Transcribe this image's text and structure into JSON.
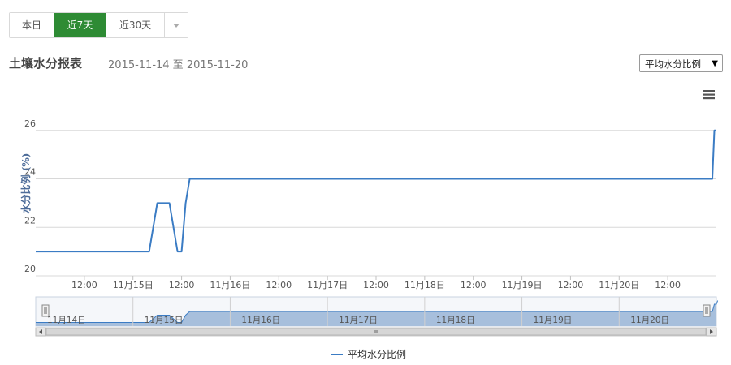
{
  "tabs": [
    {
      "label": "本日",
      "active": false
    },
    {
      "label": "近7天",
      "active": true
    },
    {
      "label": "近30天",
      "active": false
    }
  ],
  "title": "土壤水分报表",
  "date_range": "2015-11-14 至 2015-11-20",
  "metric_select": {
    "value": "平均水分比例"
  },
  "colors": {
    "accent": "#2e8b34",
    "series": "#3b7cc4",
    "navigator_fill": "#a7bfdc"
  },
  "chart_data": {
    "type": "line",
    "ylabel": "水分比例 (%)",
    "ylim": [
      20,
      27.9
    ],
    "yticks": [
      20,
      22,
      24,
      26
    ],
    "x_range": [
      "2015-11-14 00:00",
      "2015-11-21 00:00"
    ],
    "x_tick_labels": [
      "12:00",
      "11月15日",
      "12:00",
      "11月16日",
      "12:00",
      "11月17日",
      "12:00",
      "11月18日",
      "12:00",
      "11月19日",
      "12:00",
      "11月20日",
      "12:00"
    ],
    "navigator_labels": [
      "11月14日",
      "11月15日",
      "11月16日",
      "11月17日",
      "11月18日",
      "11月19日",
      "11月20日"
    ],
    "series": [
      {
        "name": "平均水分比例",
        "x": [
          "2015-11-14 00:00",
          "2015-11-15 04:00",
          "2015-11-15 06:00",
          "2015-11-15 09:00",
          "2015-11-15 11:00",
          "2015-11-15 12:00",
          "2015-11-15 13:00",
          "2015-11-15 14:00",
          "2015-11-15 15:00",
          "2015-11-20 23:00",
          "2015-11-20 23:30",
          "2015-11-21 00:00",
          "2015-11-21 00:20"
        ],
        "values": [
          21,
          21,
          23,
          23,
          21,
          21,
          23,
          24,
          24,
          24,
          26,
          26,
          27
        ]
      }
    ],
    "legend": "bottom-center",
    "grid": true
  }
}
